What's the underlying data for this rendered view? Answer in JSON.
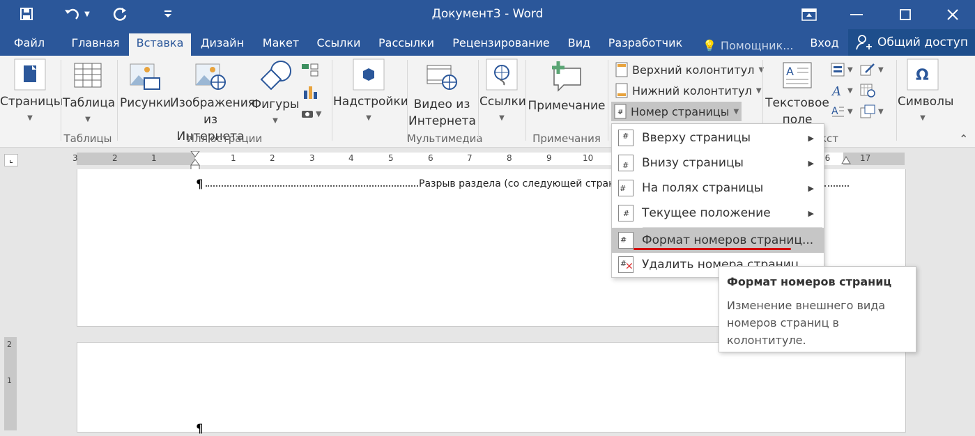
{
  "window": {
    "title": "Документ3 - Word"
  },
  "tabs": [
    {
      "label": "Файл"
    },
    {
      "label": "Главная"
    },
    {
      "label": "Вставка"
    },
    {
      "label": "Дизайн"
    },
    {
      "label": "Макет"
    },
    {
      "label": "Ссылки"
    },
    {
      "label": "Рассылки"
    },
    {
      "label": "Рецензирование"
    },
    {
      "label": "Вид"
    },
    {
      "label": "Разработчик"
    },
    {
      "label": "Помощник..."
    },
    {
      "label": "Вход"
    }
  ],
  "active_tab": "Вставка",
  "share_label": "Общий доступ",
  "ribbon": {
    "pages": "Страницы",
    "table": "Таблица",
    "tables_group": "Таблицы",
    "pictures": "Рисунки",
    "online_pictures_1": "Изображения",
    "online_pictures_2": "из Интернета",
    "shapes": "Фигуры",
    "illustrations_group": "Иллюстрации",
    "addins": "Надстройки",
    "video_1": "Видео из",
    "video_2": "Интернета",
    "media_group": "Мультимедиа",
    "links": "Ссылки",
    "comment": "Примечание",
    "comments_group": "Примечания",
    "header": "Верхний колонтитул",
    "footer": "Нижний колонтитул",
    "page_number": "Номер страницы",
    "textbox_1": "Текстовое",
    "textbox_2": "поле",
    "text_group": "кст",
    "symbols": "Символы"
  },
  "ruler_numbers": [
    "3",
    "2",
    "1",
    "1",
    "2",
    "3",
    "4",
    "5",
    "6",
    "7",
    "8",
    "9",
    "10",
    "16",
    "17"
  ],
  "vruler_numbers": [
    "2",
    "1"
  ],
  "document": {
    "pilcrow": "¶",
    "section_break": "Разрыв раздела (со следующей стран"
  },
  "page_number_menu": {
    "items": [
      {
        "label": "Вверху страницы",
        "submenu": true
      },
      {
        "label": "Внизу страницы",
        "submenu": true
      },
      {
        "label": "На полях страницы",
        "submenu": true
      },
      {
        "label": "Текущее положение",
        "submenu": true
      },
      {
        "label": "Формат номеров страниц...",
        "submenu": false
      },
      {
        "label": "Удалить номера страниц",
        "submenu": false
      }
    ],
    "highlighted_index": 4
  },
  "tooltip": {
    "title": "Формат номеров страниц",
    "description": "Изменение внешнего вида номеров страниц в колонтитуле."
  },
  "colors": {
    "accent": "#2b579a",
    "annotation_underline": "#d40000"
  }
}
